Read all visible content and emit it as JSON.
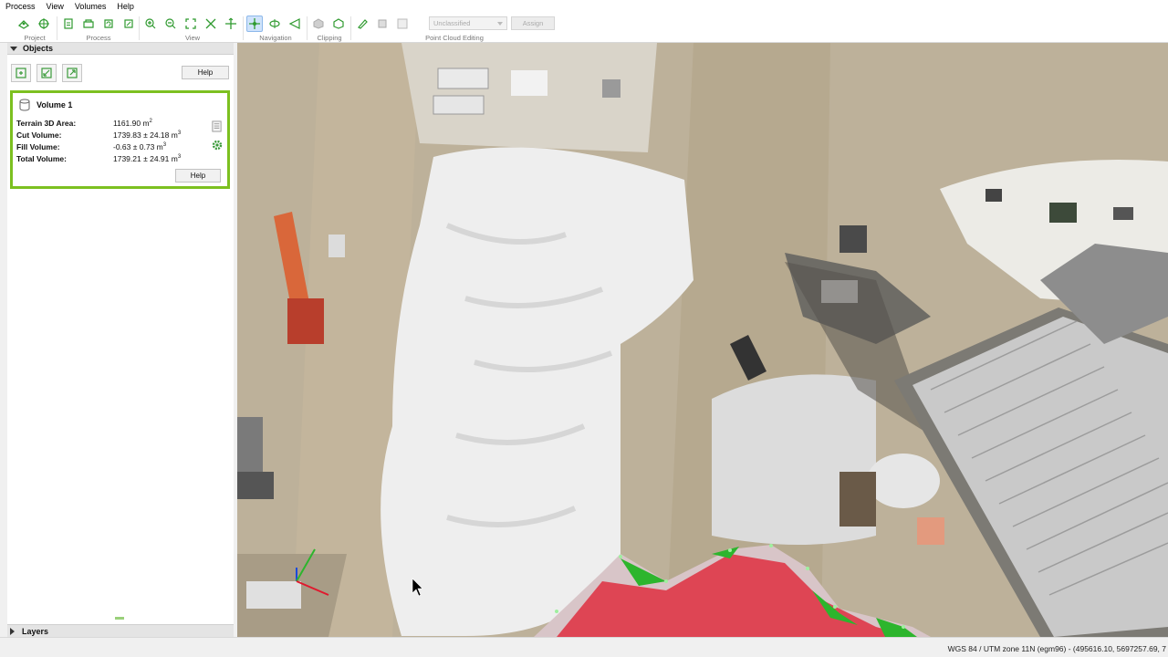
{
  "menu": [
    "Process",
    "View",
    "Volumes",
    "Help"
  ],
  "toolbar": {
    "groups": {
      "project": "Project",
      "process": "Process",
      "view": "View",
      "navigation": "Navigation",
      "clipping": "Clipping",
      "point_cloud_editing": "Point Cloud Editing"
    },
    "class_select": "Unclassified",
    "assign_label": "Assign"
  },
  "objects_panel": {
    "title": "Objects",
    "help_label": "Help",
    "volume": {
      "name": "Volume 1",
      "rows": [
        {
          "label": "Terrain 3D Area:",
          "value": "1161.90 m",
          "unit_sup": "2"
        },
        {
          "label": "Cut Volume:",
          "value": "1739.83 ± 24.18 m",
          "unit_sup": "3"
        },
        {
          "label": "Fill Volume:",
          "value": "-0.63 ± 0.73 m",
          "unit_sup": "3"
        },
        {
          "label": "Total Volume:",
          "value": "1739.21 ± 24.91 m",
          "unit_sup": "3"
        }
      ],
      "help_label": "Help"
    }
  },
  "layers_panel": {
    "title": "Layers"
  },
  "status": {
    "coords": "WGS 84 / UTM zone 11N (egm96) - (495616.10, 5697257.69, 7"
  },
  "colors": {
    "selection_green": "#7cc020",
    "cut_red": "#e0192e",
    "fill_green": "#2db52d"
  },
  "icons": [
    "project-icon",
    "process-icon",
    "zoom-in-icon",
    "zoom-out-icon",
    "navigate-icon",
    "clipping-icon",
    "edit-brush-icon",
    "volume-icon",
    "gear-icon",
    "report-icon"
  ]
}
